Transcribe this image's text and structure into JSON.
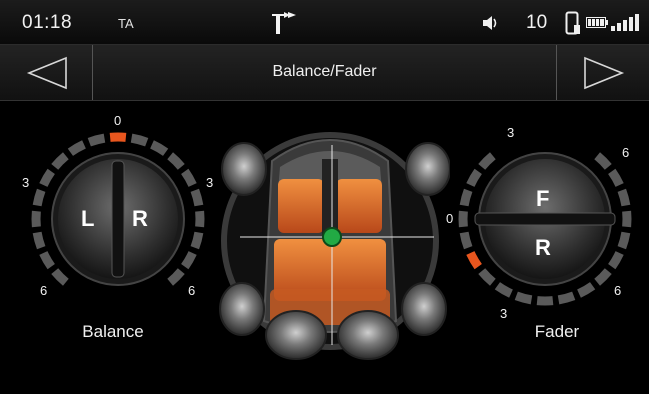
{
  "status": {
    "time": "01:18",
    "ta": "TA",
    "volume": "10",
    "icons": [
      "navigation-turn-icon",
      "speaker-icon",
      "phone-icon",
      "battery-icon",
      "signal-icon"
    ]
  },
  "header": {
    "title": "Balance/Fader"
  },
  "balance": {
    "label": "Balance",
    "left_letter": "L",
    "right_letter": "R",
    "top_mark": "0",
    "left_mark": "3",
    "left_bottom_mark": "6",
    "right_mark": "3",
    "right_bottom_mark": "6"
  },
  "fader": {
    "label": "Fader",
    "front_letter": "F",
    "rear_letter": "R",
    "top_mark_left": "3",
    "top_mark_right": "6",
    "mid_mark": "0",
    "bottom_mark_left": "3",
    "bottom_mark_right": "6"
  },
  "colors": {
    "accent": "#e8561e",
    "seat_orange": "#e07a2a",
    "center_dot": "#22aa44"
  }
}
